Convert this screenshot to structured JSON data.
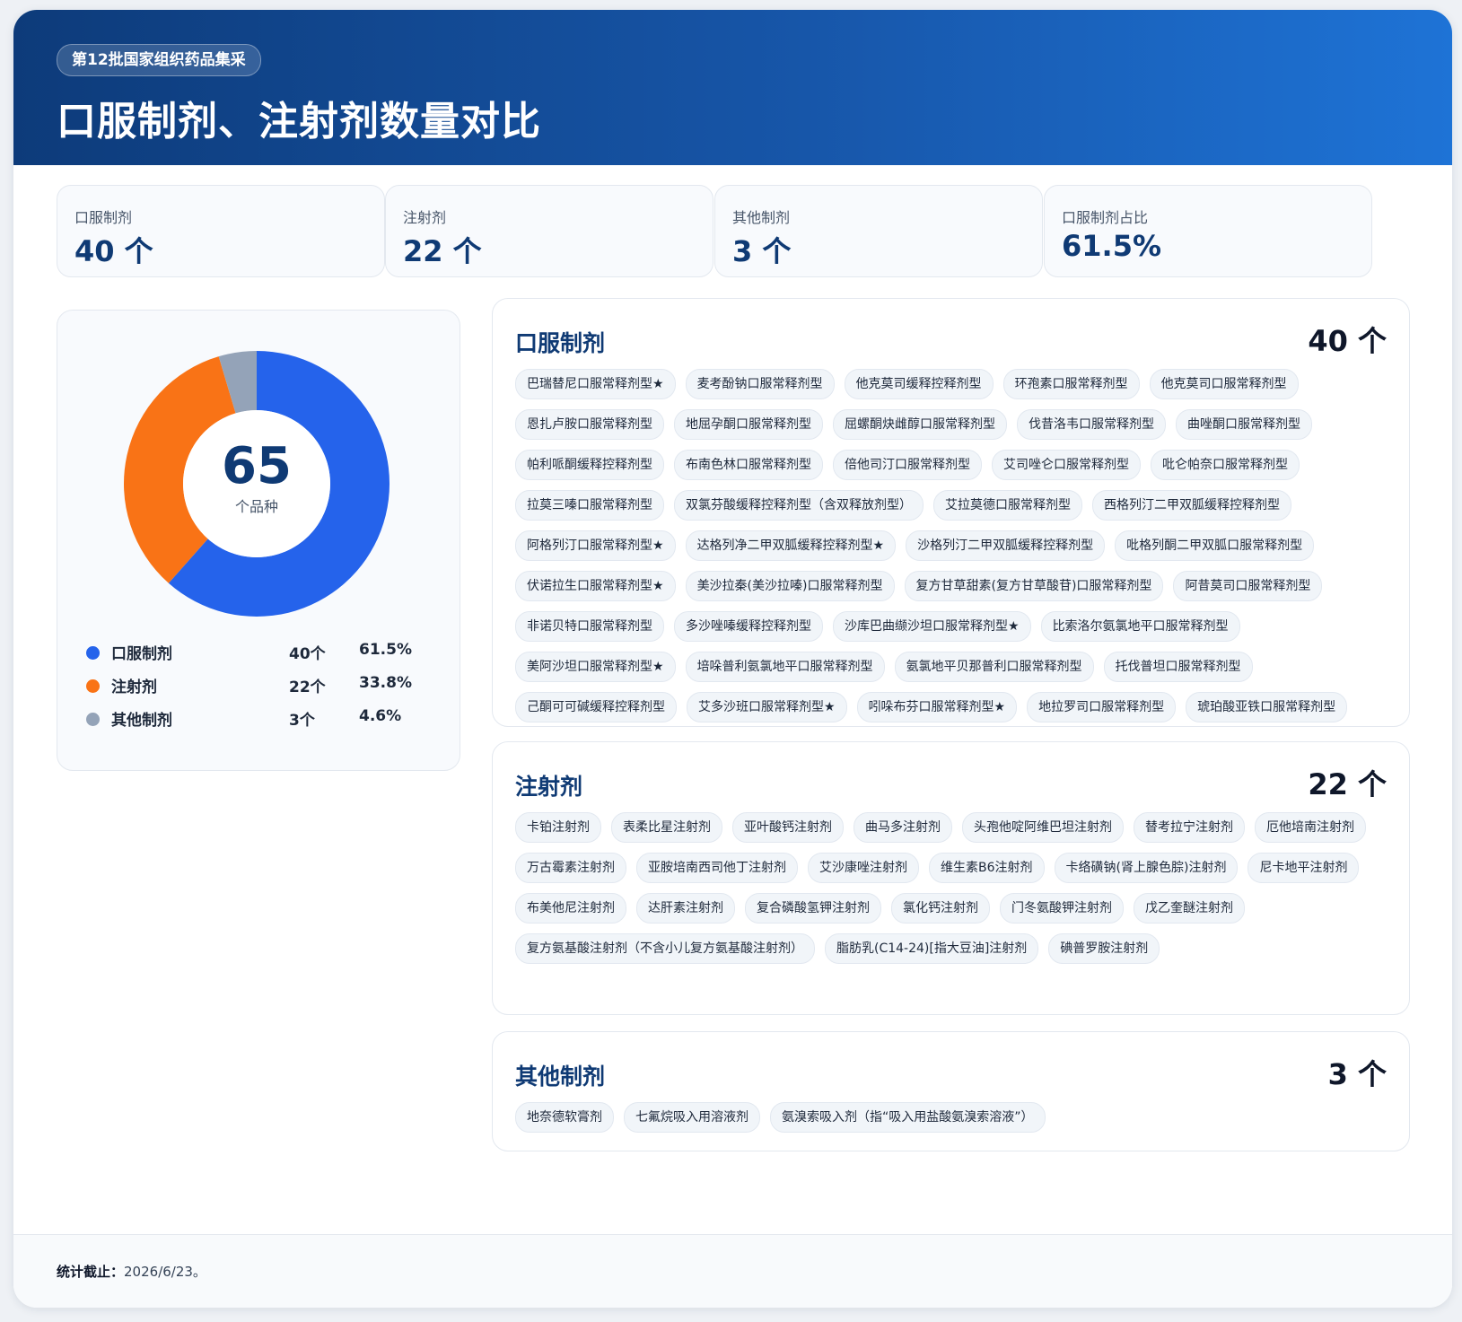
{
  "header": {
    "badge": "第12批国家组织药品集采",
    "title": "口服制剂、注射剂数量对比"
  },
  "stats": [
    {
      "label": "口服制剂",
      "value": "40 个"
    },
    {
      "label": "注射剂",
      "value": "22 个"
    },
    {
      "label": "其他制剂",
      "value": "3 个"
    },
    {
      "label": "口服制剂占比",
      "value": "61.5%"
    }
  ],
  "colors": {
    "oral": "#2563eb",
    "injection": "#f97316",
    "other": "#94a3b8",
    "title_blue": "#0f3a74"
  },
  "chart_data": {
    "type": "pie",
    "donut": true,
    "center_value": "65",
    "center_label": "个品种",
    "categories": [
      "口服制剂",
      "注射剂",
      "其他制剂"
    ],
    "values": [
      40,
      22,
      3
    ],
    "count_labels": [
      "40个",
      "22个",
      "3个"
    ],
    "percent_labels": [
      "61.5%",
      "33.8%",
      "4.6%"
    ],
    "legend_position": "bottom"
  },
  "groups": [
    {
      "title": "口服制剂",
      "count": "40 个",
      "items": [
        "巴瑞替尼口服常释剂型★",
        "麦考酚钠口服常释剂型",
        "他克莫司缓释控释剂型",
        "环孢素口服常释剂型",
        "他克莫司口服常释剂型",
        "恩扎卢胺口服常释剂型",
        "地屈孕酮口服常释剂型",
        "屈螺酮炔雌醇口服常释剂型",
        "伐昔洛韦口服常释剂型",
        "曲唑酮口服常释剂型",
        "帕利哌酮缓释控释剂型",
        "布南色林口服常释剂型",
        "倍他司汀口服常释剂型",
        "艾司唑仑口服常释剂型",
        "吡仑帕奈口服常释剂型",
        "拉莫三嗪口服常释剂型",
        "双氯芬酸缓释控释剂型（含双释放剂型）",
        "艾拉莫德口服常释剂型",
        "西格列汀二甲双胍缓释控释剂型",
        "阿格列汀口服常释剂型★",
        "达格列净二甲双胍缓释控释剂型★",
        "沙格列汀二甲双胍缓释控释剂型",
        "吡格列酮二甲双胍口服常释剂型",
        "伏诺拉生口服常释剂型★",
        "美沙拉秦(美沙拉嗪)口服常释剂型",
        "复方甘草甜素(复方甘草酸苷)口服常释剂型",
        "阿昔莫司口服常释剂型",
        "非诺贝特口服常释剂型",
        "多沙唑嗪缓释控释剂型",
        "沙库巴曲缬沙坦口服常释剂型★",
        "比索洛尔氨氯地平口服常释剂型",
        "美阿沙坦口服常释剂型★",
        "培哚普利氨氯地平口服常释剂型",
        "氨氯地平贝那普利口服常释剂型",
        "托伐普坦口服常释剂型",
        "己酮可可碱缓释控释剂型",
        "艾多沙班口服常释剂型★",
        "吲哚布芬口服常释剂型★",
        "地拉罗司口服常释剂型",
        "琥珀酸亚铁口服常释剂型"
      ]
    },
    {
      "title": "注射剂",
      "count": "22 个",
      "items": [
        "卡铂注射剂",
        "表柔比星注射剂",
        "亚叶酸钙注射剂",
        "曲马多注射剂",
        "头孢他啶阿维巴坦注射剂",
        "替考拉宁注射剂",
        "厄他培南注射剂",
        "万古霉素注射剂",
        "亚胺培南西司他丁注射剂",
        "艾沙康唑注射剂",
        "维生素B6注射剂",
        "卡络磺钠(肾上腺色腙)注射剂",
        "尼卡地平注射剂",
        "布美他尼注射剂",
        "达肝素注射剂",
        "复合磷酸氢钾注射剂",
        "氯化钙注射剂",
        "门冬氨酸钾注射剂",
        "戊乙奎醚注射剂",
        "复方氨基酸注射剂（不含小儿复方氨基酸注射剂）",
        "脂肪乳(C14-24)[指大豆油]注射剂",
        "碘普罗胺注射剂"
      ]
    },
    {
      "title": "其他制剂",
      "count": "3 个",
      "items": [
        "地奈德软膏剂",
        "七氟烷吸入用溶液剂",
        "氨溴索吸入剂（指“吸入用盐酸氨溴索溶液”）"
      ]
    }
  ],
  "footer": {
    "label": "统计截止：",
    "value": "2026/6/23。"
  }
}
